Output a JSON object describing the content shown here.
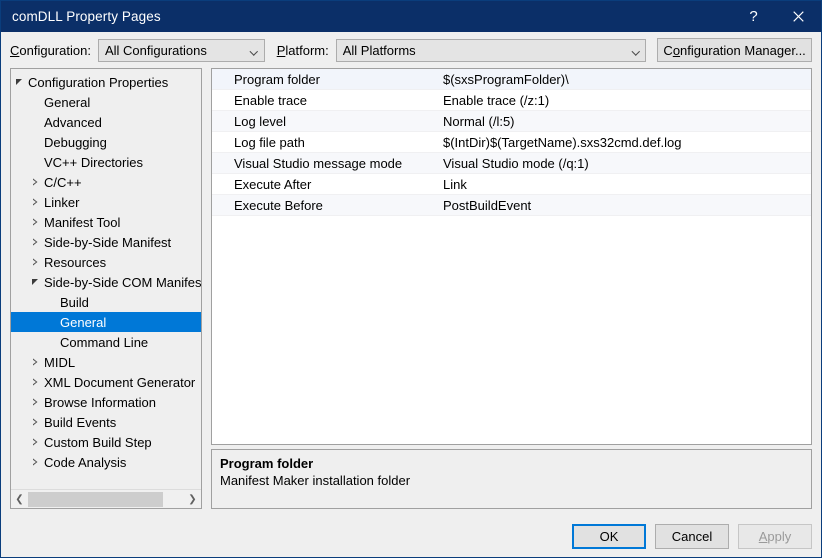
{
  "window": {
    "title": "comDLL Property Pages",
    "help_icon": "question-mark-icon",
    "close_icon": "close-icon"
  },
  "configbar": {
    "configuration_label_pre": "C",
    "configuration_label_accel": "o",
    "configuration_label_post": "nfiguration:",
    "configuration_label": "Configuration:",
    "configuration_value": "All Configurations",
    "platform_label": "Platform:",
    "platform_label_accel": "P",
    "platform_label_post": "latform:",
    "platform_value": "All Platforms",
    "config_manager_pre": "C",
    "config_manager_accel": "o",
    "config_manager_post": "nfiguration Manager...",
    "config_manager_label": "Configuration Manager..."
  },
  "tree": {
    "items": [
      {
        "label": "Configuration Properties",
        "indent": 0,
        "expander": "expanded",
        "selected": false
      },
      {
        "label": "General",
        "indent": 1,
        "expander": "none",
        "selected": false
      },
      {
        "label": "Advanced",
        "indent": 1,
        "expander": "none",
        "selected": false
      },
      {
        "label": "Debugging",
        "indent": 1,
        "expander": "none",
        "selected": false
      },
      {
        "label": "VC++ Directories",
        "indent": 1,
        "expander": "none",
        "selected": false
      },
      {
        "label": "C/C++",
        "indent": 1,
        "expander": "collapsed",
        "selected": false
      },
      {
        "label": "Linker",
        "indent": 1,
        "expander": "collapsed",
        "selected": false
      },
      {
        "label": "Manifest Tool",
        "indent": 1,
        "expander": "collapsed",
        "selected": false
      },
      {
        "label": "Side-by-Side Manifest",
        "indent": 1,
        "expander": "collapsed",
        "selected": false
      },
      {
        "label": "Resources",
        "indent": 1,
        "expander": "collapsed",
        "selected": false
      },
      {
        "label": "Side-by-Side COM Manifest",
        "indent": 1,
        "expander": "expanded",
        "selected": false
      },
      {
        "label": "Build",
        "indent": 2,
        "expander": "none",
        "selected": false
      },
      {
        "label": "General",
        "indent": 2,
        "expander": "none",
        "selected": true
      },
      {
        "label": "Command Line",
        "indent": 2,
        "expander": "none",
        "selected": false
      },
      {
        "label": "MIDL",
        "indent": 1,
        "expander": "collapsed",
        "selected": false
      },
      {
        "label": "XML Document Generator",
        "indent": 1,
        "expander": "collapsed",
        "selected": false
      },
      {
        "label": "Browse Information",
        "indent": 1,
        "expander": "collapsed",
        "selected": false
      },
      {
        "label": "Build Events",
        "indent": 1,
        "expander": "collapsed",
        "selected": false
      },
      {
        "label": "Custom Build Step",
        "indent": 1,
        "expander": "collapsed",
        "selected": false
      },
      {
        "label": "Code Analysis",
        "indent": 1,
        "expander": "collapsed",
        "selected": false
      }
    ],
    "scrollbar": {
      "left_arrow": "chevron-left-icon",
      "right_arrow": "chevron-right-icon"
    }
  },
  "grid": {
    "rows": [
      {
        "name": "Program folder",
        "value": "$(sxsProgramFolder)\\"
      },
      {
        "name": "Enable trace",
        "value": "Enable trace (/z:1)"
      },
      {
        "name": "Log level",
        "value": "Normal (/l:5)"
      },
      {
        "name": "Log file path",
        "value": "$(IntDir)$(TargetName).sxs32cmd.def.log"
      },
      {
        "name": "Visual Studio message mode",
        "value": "Visual Studio mode (/q:1)"
      },
      {
        "name": "Execute After",
        "value": "Link"
      },
      {
        "name": "Execute Before",
        "value": "PostBuildEvent"
      }
    ]
  },
  "description": {
    "title": "Program folder",
    "text": "Manifest Maker installation folder"
  },
  "footer": {
    "ok_label": "OK",
    "cancel_label": "Cancel",
    "apply_pre": "A",
    "apply_accel": "A",
    "apply_post": "pply",
    "apply_label": "Apply",
    "apply_enabled": false
  },
  "colors": {
    "titlebar": "#0b2f68",
    "accent": "#0078d7",
    "dialog_bg": "#efefef",
    "grid_bg": "#ffffff"
  }
}
